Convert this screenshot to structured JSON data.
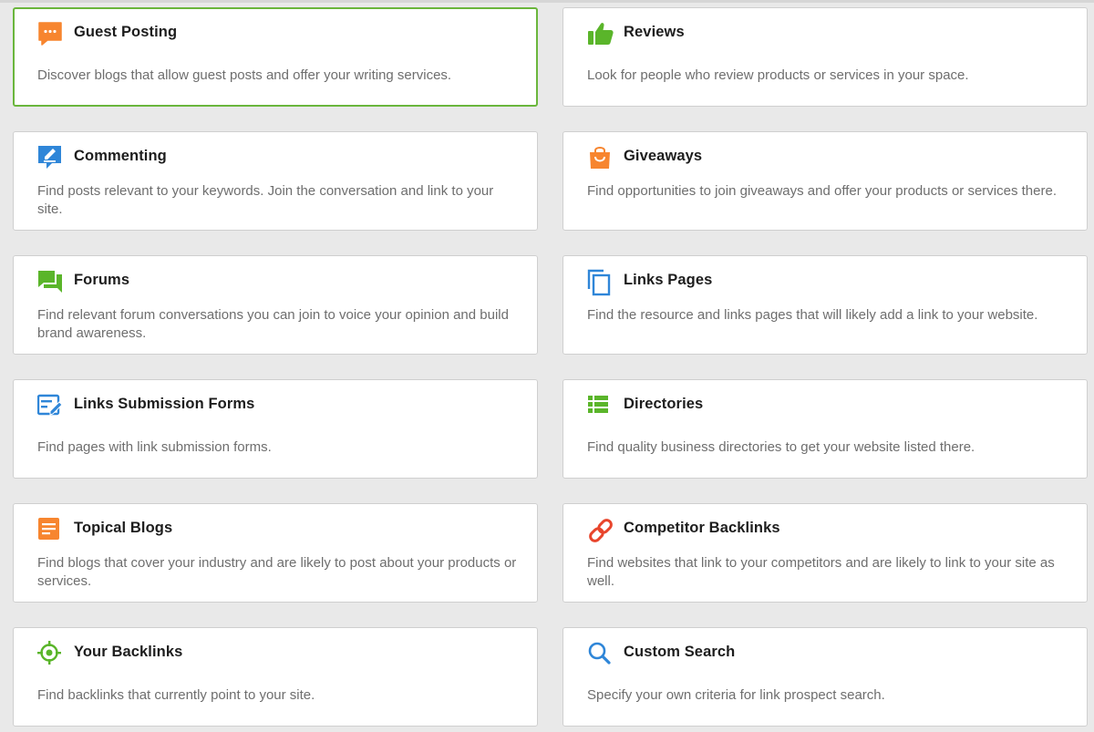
{
  "colors": {
    "selected_border": "#6ab63c",
    "card_border": "#cfcfcf",
    "title": "#1d1d1d",
    "description": "#6e6e6e",
    "orange": "#f7852f",
    "green": "#5ab52a",
    "blue": "#2f86d8",
    "red": "#e8452c"
  },
  "cards": [
    {
      "title": "Guest Posting",
      "description": "Discover blogs that allow guest posts and offer your writing services.",
      "icon": "chat-bubble-icon",
      "selected": true
    },
    {
      "title": "Reviews",
      "description": "Look for people who review products or services in your space.",
      "icon": "thumbs-up-icon"
    },
    {
      "title": "Commenting",
      "description": "Find posts relevant to your keywords. Join the conversation and link to your site.",
      "icon": "comment-edit-icon"
    },
    {
      "title": "Giveaways",
      "description": "Find opportunities to join giveaways and offer your products or services there.",
      "icon": "shopping-bag-icon"
    },
    {
      "title": "Forums",
      "description": "Find relevant forum conversations you can join to voice your opinion and build brand awareness.",
      "icon": "forum-icon"
    },
    {
      "title": "Links Pages",
      "description": "Find the resource and links pages that will likely add a link to your website.",
      "icon": "copy-pages-icon"
    },
    {
      "title": "Links Submission Forms",
      "description": "Find pages with link submission forms.",
      "icon": "form-edit-icon"
    },
    {
      "title": "Directories",
      "description": "Find quality business directories to get your website listed there.",
      "icon": "list-icon"
    },
    {
      "title": "Topical Blogs",
      "description": "Find blogs that cover your industry and are likely to post about your products or services.",
      "icon": "document-icon"
    },
    {
      "title": "Competitor Backlinks",
      "description": "Find websites that link to your competitors and are likely to link to your site as well.",
      "icon": "chain-link-icon"
    },
    {
      "title": "Your Backlinks",
      "description": "Find backlinks that currently point to your site.",
      "icon": "crosshair-icon"
    },
    {
      "title": "Custom Search",
      "description": "Specify your own criteria for link prospect search.",
      "icon": "search-icon"
    }
  ]
}
